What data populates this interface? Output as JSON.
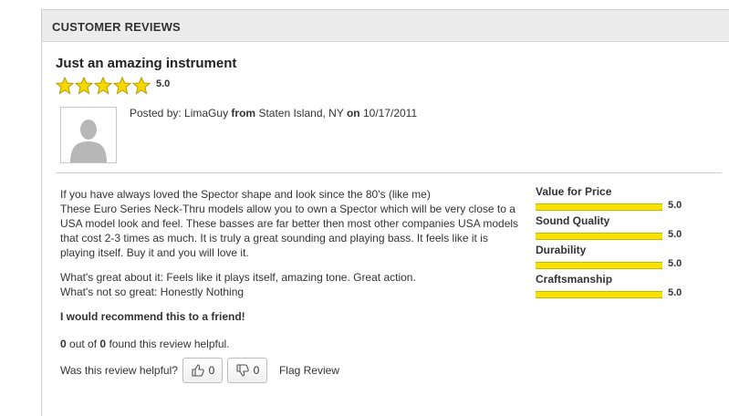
{
  "section": {
    "title": "CUSTOMER REVIEWS"
  },
  "review": {
    "title": "Just an amazing instrument",
    "stars": 5,
    "overall": "5.0",
    "posted_by_label": "Posted by:",
    "author": "LimaGuy",
    "from_label": "from",
    "location": "Staten Island, NY",
    "on_label": "on",
    "date": "10/17/2011",
    "body": [
      "If you have always loved the Spector shape and look since the 80's (like me)",
      "These Euro Series Neck-Thru models allow you to own a Spector which will be very close to a USA model look and feel. These basses are far better then most other companies USA models that cost 2-3 times as much. It is truly a great sounding and playing bass. It feels like it is playing itself. Buy it and you will love it."
    ],
    "pros": "What's great about it: Feels like it plays itself, amazing tone. Great action.",
    "cons": "What's not so great: Honestly Nothing",
    "recommend": "I would recommend this to a friend!",
    "helpful": {
      "found": "0",
      "out_of_label": "out of",
      "total": "0",
      "suffix": "found this review helpful."
    },
    "vote": {
      "question": "Was this review helpful?",
      "yes_count": "0",
      "no_count": "0",
      "flag_label": "Flag Review"
    }
  },
  "ratings": [
    {
      "label": "Value for Price",
      "value": "5.0",
      "fraction": 1.0
    },
    {
      "label": "Sound Quality",
      "value": "5.0",
      "fraction": 1.0
    },
    {
      "label": "Durability",
      "value": "5.0",
      "fraction": 1.0
    },
    {
      "label": "Craftsmanship",
      "value": "5.0",
      "fraction": 1.0
    }
  ],
  "colors": {
    "star": "#f5d800",
    "bar": "#f7e200",
    "header_bg": "#ececec"
  },
  "icons": {
    "avatar": "default-user-silhouette",
    "thumbs_up": "thumbs-up-icon",
    "thumbs_down": "thumbs-down-icon",
    "star": "star-icon"
  }
}
